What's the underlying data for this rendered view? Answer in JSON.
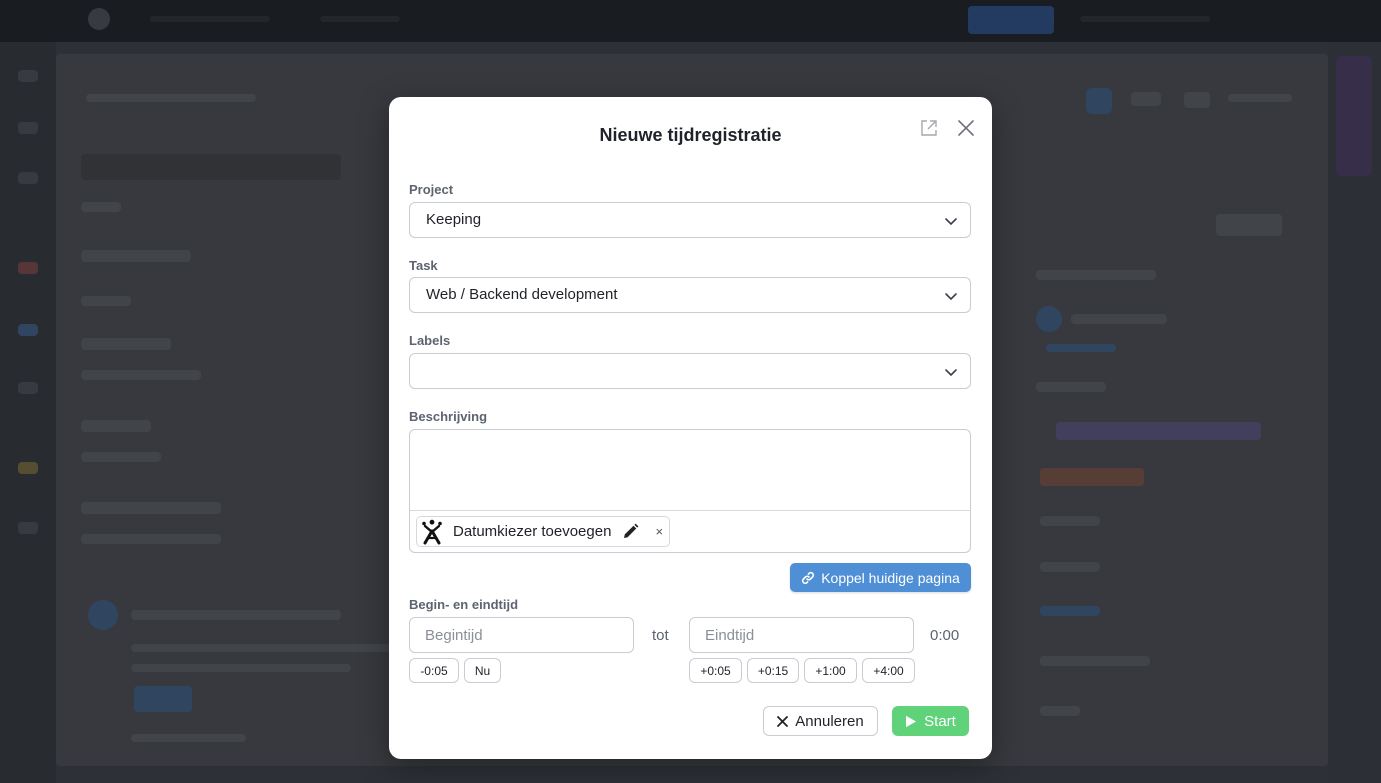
{
  "modal": {
    "title": "Nieuwe tijdregistratie",
    "popout_icon": "external-link-icon",
    "close_icon": "close-icon"
  },
  "project": {
    "label": "Project",
    "value": "Keeping"
  },
  "task": {
    "label": "Task",
    "value": "Web / Backend development"
  },
  "labels": {
    "label": "Labels",
    "value": ""
  },
  "description": {
    "label": "Beschrijving",
    "value": "",
    "chip": {
      "text": "Datumkiezer toevoegen",
      "remove": "×",
      "logo_icon": "confluence-logo-icon",
      "edit_icon": "pencil-icon"
    },
    "link_button": "Koppel huidige pagina",
    "link_icon": "link-icon"
  },
  "times": {
    "label": "Begin- en eindtijd",
    "start_placeholder": "Begintijd",
    "end_placeholder": "Eindtijd",
    "separator": "tot",
    "duration": "0:00",
    "start_adjust": [
      "-0:05",
      "Nu"
    ],
    "end_adjust": [
      "+0:05",
      "+0:15",
      "+1:00",
      "+4:00"
    ]
  },
  "footer": {
    "cancel": "Annuleren",
    "start": "Start",
    "start_color": "#5fd27a",
    "link_color": "#4f8fd6"
  }
}
